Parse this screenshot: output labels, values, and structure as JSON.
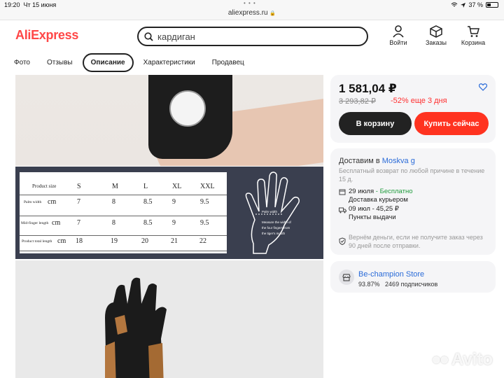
{
  "status": {
    "time": "19:20",
    "date": "Чт 15 июня",
    "battery": "37 %",
    "url": "aliexpress.ru"
  },
  "header": {
    "logo": "AliExpress",
    "search_value": "кардиган",
    "login_label": "Войти",
    "orders_label": "Заказы",
    "cart_label": "Корзина"
  },
  "tabs": [
    {
      "label": "Фото",
      "active": false
    },
    {
      "label": "Отзывы",
      "active": false
    },
    {
      "label": "Описание",
      "active": true
    },
    {
      "label": "Характеристики",
      "active": false
    },
    {
      "label": "Продавец",
      "active": false
    }
  ],
  "size_chart": {
    "headers": [
      "Product size",
      "S",
      "M",
      "L",
      "XL",
      "XXL"
    ],
    "rows": [
      {
        "label": "Palm width",
        "unit": "cm",
        "values": [
          "7",
          "8",
          "8.5",
          "9",
          "9.5"
        ]
      },
      {
        "label": "Mid-finger length",
        "unit": "cm",
        "values": [
          "7",
          "8",
          "8.5",
          "9",
          "9.5"
        ]
      },
      {
        "label": "Product total length",
        "unit": "cm",
        "values": [
          "18",
          "19",
          "20",
          "21",
          "22"
        ]
      }
    ],
    "hand_labels": [
      "Palm width",
      "Measure the width of",
      "the four fingers from",
      "the tiger's mouth"
    ]
  },
  "product": {
    "price": "1 581,04 ₽",
    "old_price": "3 293,82 ₽",
    "discount": "-52% еще 3 дня",
    "cart_button": "В корзину",
    "buy_button": "Купить сейчас"
  },
  "delivery": {
    "title_prefix": "Доставим в",
    "city": "Moskva g",
    "return_note": "Бесплатный возврат по любой причине в течение 15 д.",
    "courier_date": "29 июля",
    "courier_sep": " - ",
    "courier_price": "Бесплатно",
    "courier_label": "Доставка курьером",
    "pickup_date": "09 июл - 45,25 ₽",
    "pickup_label": "Пункты выдачи",
    "guarantee": "Вернём деньги, если не получите заказ через 90 дней после отправки."
  },
  "store": {
    "name": "Be-champion Store",
    "rating": "93.87%",
    "subscribers": "2469 подписчиков"
  },
  "watermark": "Avito",
  "colors": {
    "brand": "#ff4747",
    "buy": "#ff3320",
    "link": "#2a6bd8",
    "free": "#1e9b3b"
  }
}
